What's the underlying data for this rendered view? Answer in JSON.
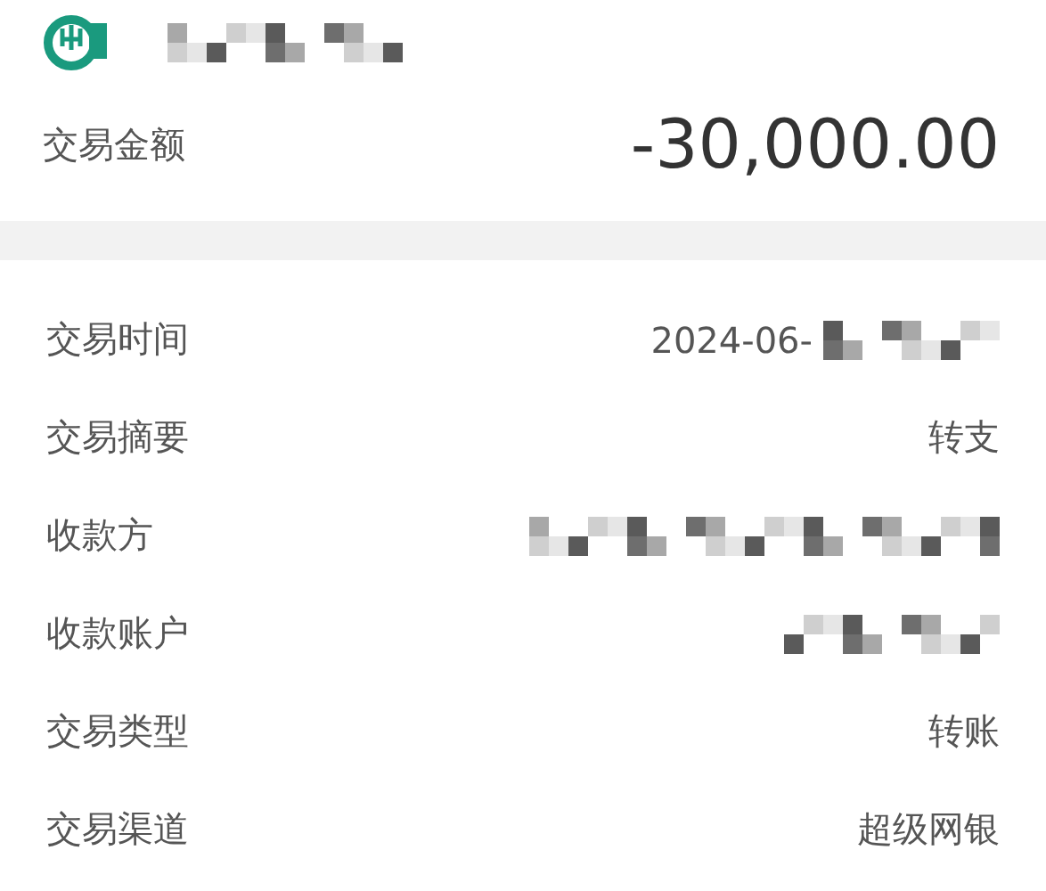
{
  "header": {
    "account_name_redacted": true
  },
  "amount": {
    "label": "交易金额",
    "value": "-30,000.00"
  },
  "details": [
    {
      "label": "交易时间",
      "value": "2024-06-",
      "redacted": true
    },
    {
      "label": "交易摘要",
      "value": "转支",
      "redacted": false
    },
    {
      "label": "收款方",
      "redacted": true
    },
    {
      "label": "收款账户",
      "redacted": true
    },
    {
      "label": "交易类型",
      "value": "转账",
      "redacted": false
    },
    {
      "label": "交易渠道",
      "value": "超级网银",
      "redacted": false
    }
  ]
}
